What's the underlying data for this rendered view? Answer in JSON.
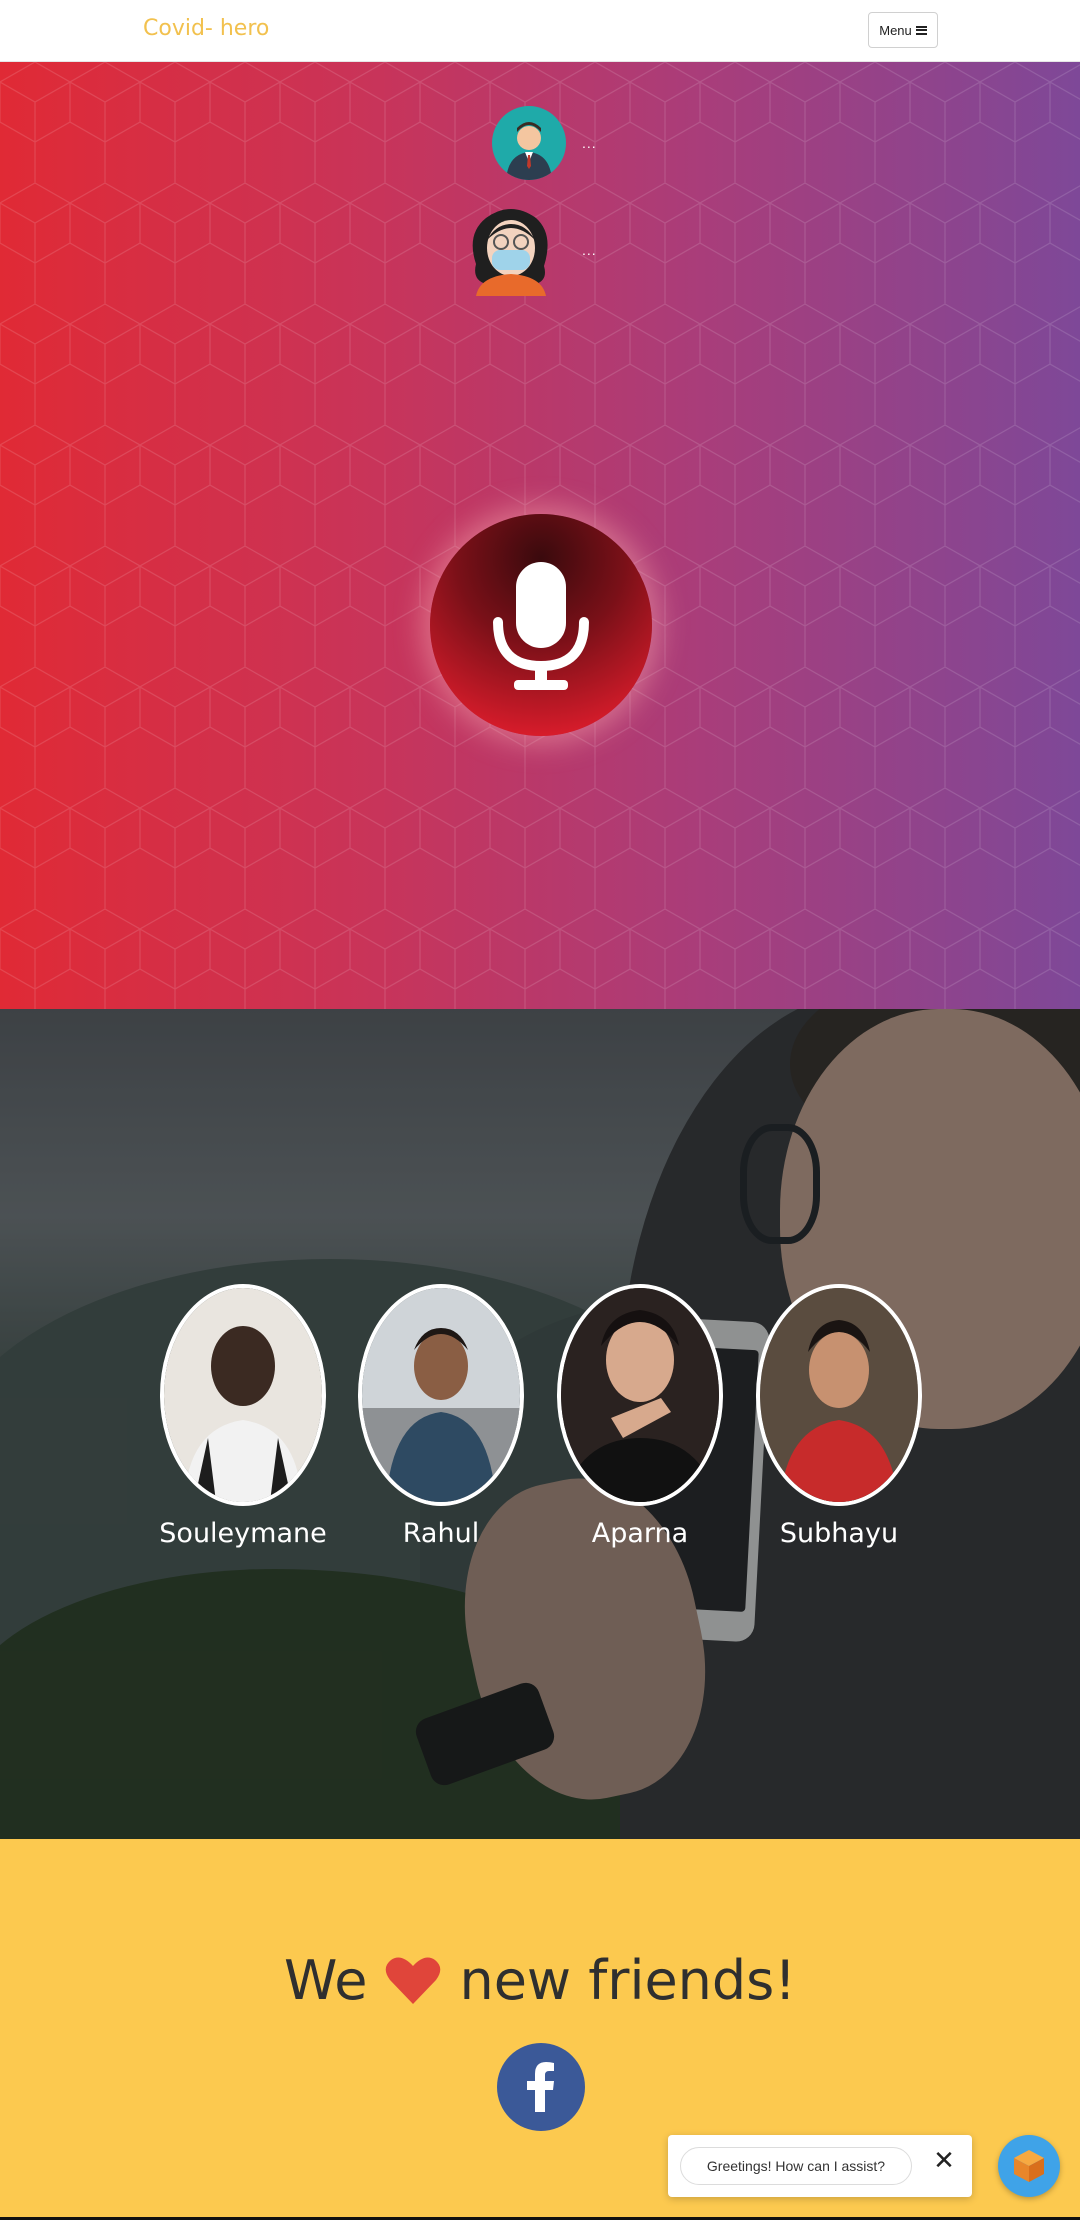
{
  "navbar": {
    "brand": "Covid- hero",
    "menu_label": "Menu",
    "menu_icon": "bars-icon"
  },
  "hero": {
    "conversation": [
      {
        "speaker": "bot",
        "avatar": "doctor-avatar",
        "text": "..."
      },
      {
        "speaker": "user",
        "avatar": "masked-woman-avatar",
        "text": "..."
      }
    ],
    "mic_icon": "microphone-icon"
  },
  "team": {
    "members": [
      {
        "name": "Souleymane"
      },
      {
        "name": "Rahul"
      },
      {
        "name": "Aparna"
      },
      {
        "name": "Subhayu"
      }
    ]
  },
  "footer": {
    "tagline_before": "We",
    "tagline_after": "new friends!",
    "heart_icon": "heart-icon",
    "social_icon": "facebook-icon"
  },
  "chat_widget": {
    "greeting": "Greetings! How can I assist?",
    "close_icon": "close-icon",
    "launcher_icon": "cube-icon"
  },
  "colors": {
    "brand": "#f2c14e",
    "hero_start": "#e02a35",
    "hero_end": "#7e4898",
    "footer_bg": "#fcc94f",
    "heart": "#e0453a",
    "facebook": "#3b5998",
    "launcher": "#3fa3e8"
  }
}
